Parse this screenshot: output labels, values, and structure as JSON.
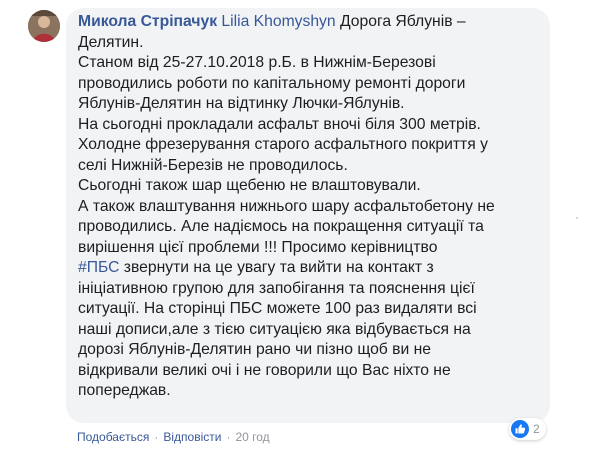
{
  "comment": {
    "author": "Микола Стріпачук",
    "mention": "Lilia Khomyshyn",
    "first_line_rest": "Дорога Яблунів –",
    "lines": [
      "Делятин.",
      "Станом від 25-27.10.2018 р.Б. в Нижнім-Березові",
      "проводились роботи по капітальному ремонті дороги",
      "Яблунів-Делятин на відтинку Лючки-Яблунів.",
      "На сьогодні прокладали асфальт вночі біля 300 метрів.",
      "Холодне фрезерування старого асфальтного покриття у",
      "селі Нижній-Березів не проводилось.",
      "Сьогодні також шар щебеню не влаштовували.",
      "А також влаштування нижнього шару асфальтобетону не",
      "проводились. Але надіємось на покращення ситуації та",
      "вирішення цієї проблеми !!! Просимо керівництво"
    ],
    "hashtag": "#ПБС",
    "hashtag_line_rest": " звернути на це увагу та вийти на контакт з",
    "lines_after": [
      "ініціативною групою для запобігання та пояснення цієї",
      "ситуації. На сторінці ПБС можете 100 раз видаляти всі",
      "наші дописи,але з тією ситуацією яка відбувається на",
      "дорозі Яблунів-Делятин рано чи пізно щоб ви не",
      "відкривали великі очі і не говорили що Вас ніхто не",
      "попереджав."
    ]
  },
  "reactions": {
    "icon": "like-icon",
    "count": "2",
    "color": "#1877f2"
  },
  "actions": {
    "like": "Подобається",
    "reply": "Відповісти",
    "separator": "·",
    "time": "20 год"
  },
  "more_options": "·",
  "colors": {
    "link": "#385898",
    "bubble": "#f2f3f5",
    "text": "#1c1e21"
  }
}
